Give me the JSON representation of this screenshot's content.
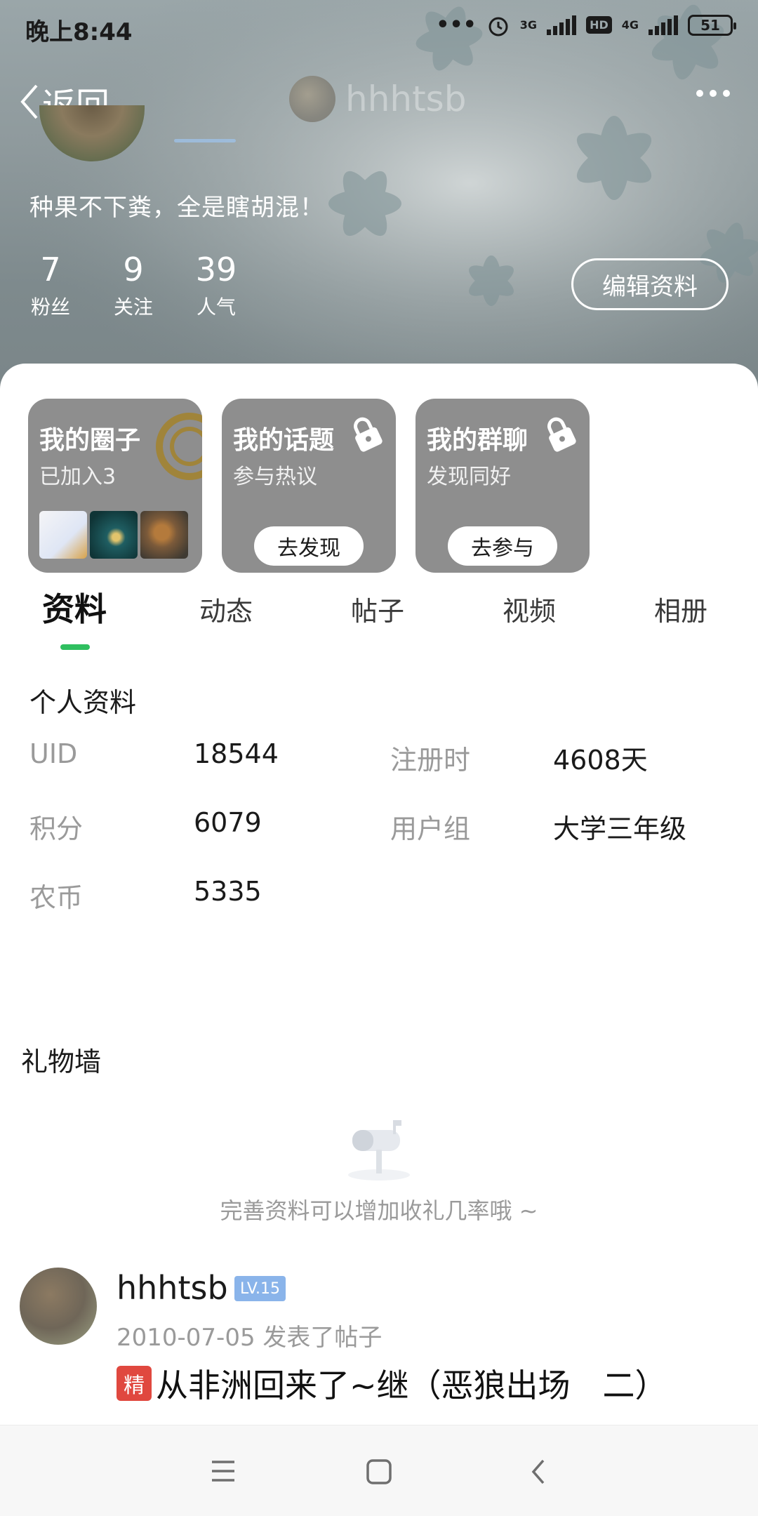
{
  "status_bar": {
    "time": "晚上8:44",
    "network_1": "3G",
    "network_2": "4G",
    "hd": "HD",
    "battery": "51"
  },
  "nav": {
    "back_label": "返回",
    "title": "hhhtsb"
  },
  "profile": {
    "bio": "种果不下粪，全是瞎胡混！",
    "stats": [
      {
        "value": "7",
        "label": "粉丝"
      },
      {
        "value": "9",
        "label": "关注"
      },
      {
        "value": "39",
        "label": "人气"
      }
    ],
    "edit_label": "编辑资料"
  },
  "cards": [
    {
      "title": "我的圈子",
      "subtitle": "已加入3"
    },
    {
      "title": "我的话题",
      "subtitle": "参与热议",
      "button": "去发现"
    },
    {
      "title": "我的群聊",
      "subtitle": "发现同好",
      "button": "去参与"
    }
  ],
  "tabs": [
    "资料",
    "动态",
    "帖子",
    "视频",
    "相册"
  ],
  "active_tab": "资料",
  "personal_info": {
    "title": "个人资料",
    "rows": [
      {
        "label": "UID",
        "value": "18544"
      },
      {
        "label": "注册时",
        "value": "4608天"
      },
      {
        "label": "积分",
        "value": "6079"
      },
      {
        "label": "用户组",
        "value": "大学三年级"
      },
      {
        "label": "农币",
        "value": "5335"
      }
    ]
  },
  "gift_wall": {
    "title": "礼物墙",
    "empty_text": "完善资料可以增加收礼几率哦 ~"
  },
  "post": {
    "author": "hhhtsb",
    "level": "LV.15",
    "meta": "2010-07-05 发表了帖子",
    "tag": "精",
    "title": "从非洲回来了~继（恶狼出场　二）"
  },
  "colors": {
    "accent_green": "#2fbf5f",
    "card_gray": "#8e8e8e",
    "level_blue": "#8ab4ea",
    "tag_red": "#e0483f"
  },
  "icons": [
    "back-chevron-icon",
    "more-dots-icon",
    "lock-icon",
    "mailbox-icon",
    "menu-icon",
    "home-square-icon",
    "back-triangle-icon"
  ]
}
